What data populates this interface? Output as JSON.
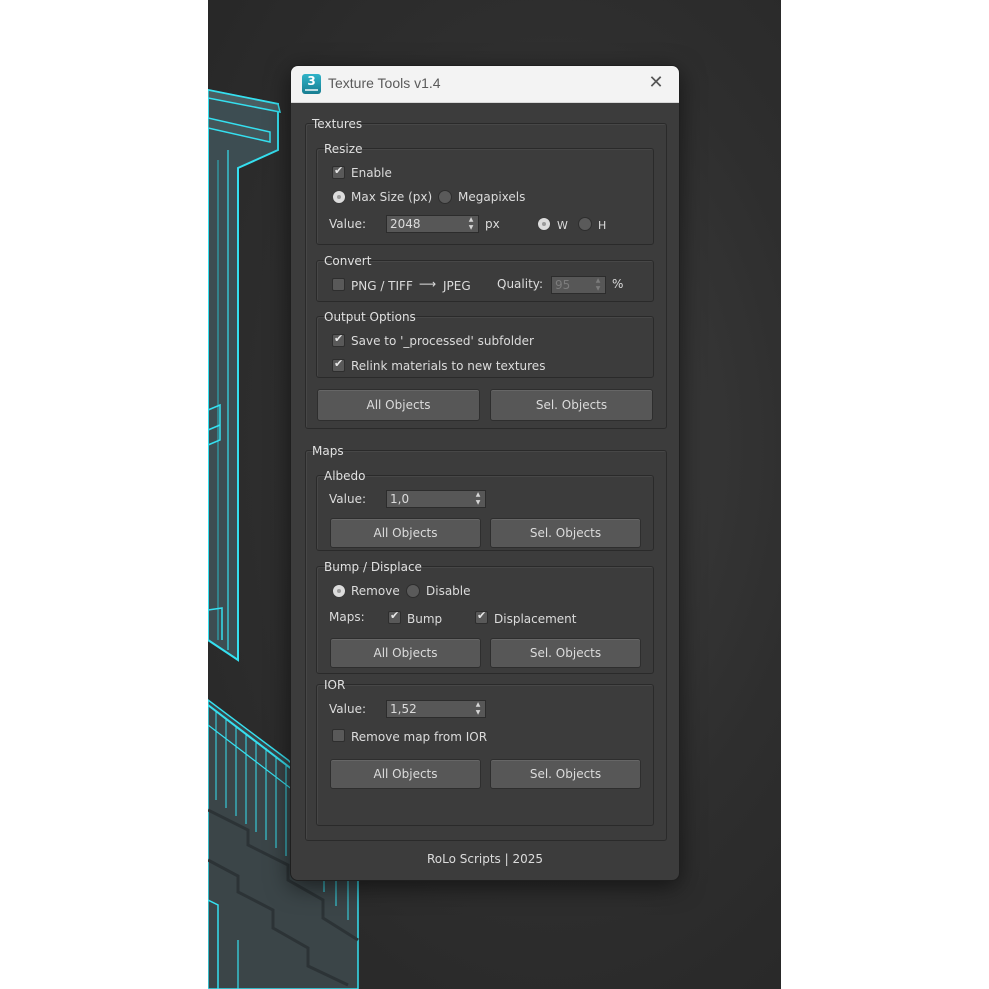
{
  "window": {
    "title": "Texture Tools v1.4",
    "app_icon_text": "3"
  },
  "textures": {
    "label": "Textures",
    "resize": {
      "label": "Resize",
      "enable_label": "Enable",
      "enable_checked": true,
      "mode_max_size_label": "Max Size (px)",
      "mode_megapixels_label": "Megapixels",
      "selected_mode": "max_size",
      "value_label": "Value:",
      "value": "2048",
      "unit": "px",
      "w_label": "W",
      "h_label": "H",
      "selected_axis": "W"
    },
    "convert": {
      "label": "Convert",
      "png_tiff_label": "PNG / TIFF",
      "arrow": "⟶",
      "jpeg_label": "JPEG",
      "checked": false,
      "quality_label": "Quality:",
      "quality_value": "95",
      "percent": "%"
    },
    "output": {
      "label": "Output Options",
      "save_label": "Save to '_processed' subfolder",
      "save_checked": true,
      "relink_label": "Relink materials to new textures",
      "relink_checked": true
    },
    "all_objects_label": "All Objects",
    "sel_objects_label": "Sel. Objects"
  },
  "maps": {
    "label": "Maps",
    "albedo": {
      "label": "Albedo",
      "value_label": "Value:",
      "value": "1,0",
      "all_objects_label": "All Objects",
      "sel_objects_label": "Sel. Objects"
    },
    "bump": {
      "label": "Bump / Displace",
      "remove_label": "Remove",
      "disable_label": "Disable",
      "selected": "remove",
      "maps_label": "Maps:",
      "bump_label": "Bump",
      "bump_checked": true,
      "displacement_label": "Displacement",
      "displacement_checked": true,
      "all_objects_label": "All Objects",
      "sel_objects_label": "Sel. Objects"
    },
    "ior": {
      "label": "IOR",
      "value_label": "Value:",
      "value": "1,52",
      "remove_map_label": "Remove map from IOR",
      "remove_map_checked": false,
      "all_objects_label": "All Objects",
      "sel_objects_label": "Sel. Objects"
    }
  },
  "footer": {
    "text": "RoLo Scripts | 2025"
  },
  "colors": {
    "wireframe": "#35e0f0",
    "panel_bg": "#3c3c3c",
    "titlebar_bg": "#f3f3f3"
  }
}
